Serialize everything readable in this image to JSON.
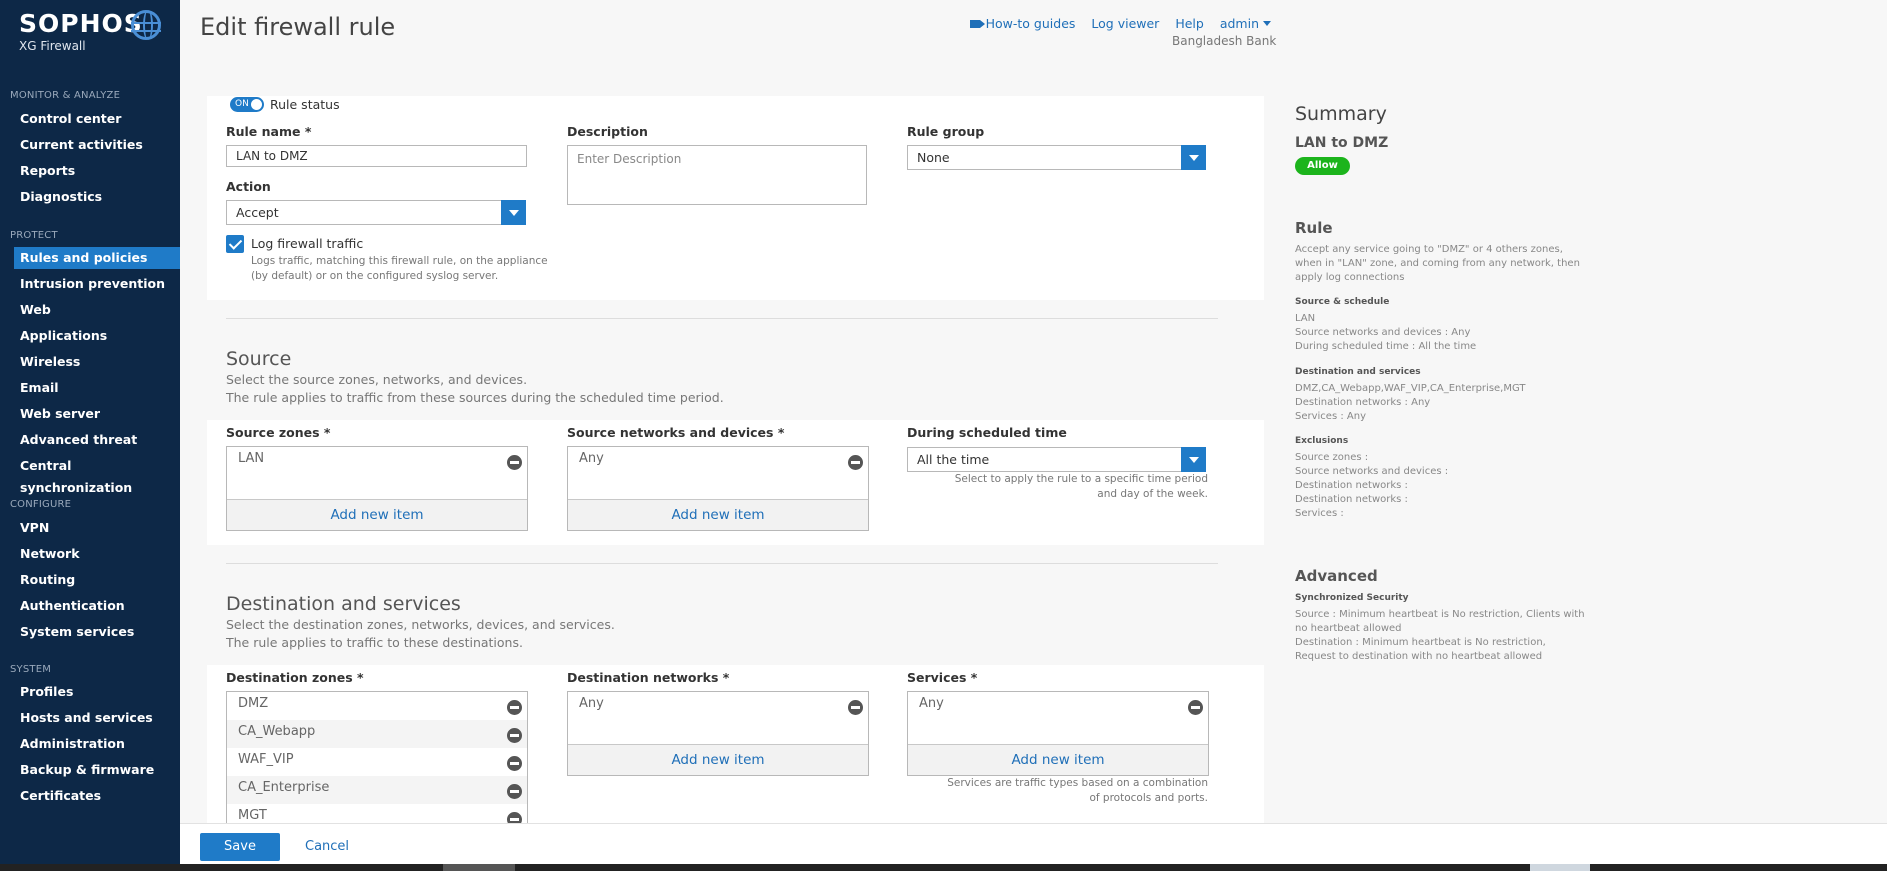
{
  "brand": {
    "name": "SOPHOS",
    "product": "XG Firewall"
  },
  "sidebar": {
    "sections": [
      {
        "title": "MONITOR & ANALYZE",
        "items": [
          "Control center",
          "Current activities",
          "Reports",
          "Diagnostics"
        ]
      },
      {
        "title": "PROTECT",
        "items": [
          "Rules and policies",
          "Intrusion prevention",
          "Web",
          "Applications",
          "Wireless",
          "Email",
          "Web server",
          "Advanced threat",
          "Central synchronization"
        ]
      },
      {
        "title": "CONFIGURE",
        "items": [
          "VPN",
          "Network",
          "Routing",
          "Authentication",
          "System services"
        ]
      },
      {
        "title": "SYSTEM",
        "items": [
          "Profiles",
          "Hosts and services",
          "Administration",
          "Backup & firmware",
          "Certificates"
        ]
      }
    ],
    "active_item": "Rules and policies"
  },
  "header": {
    "title": "Edit firewall rule",
    "links": {
      "howto": "How-to guides",
      "logviewer": "Log viewer",
      "help": "Help",
      "admin": "admin"
    },
    "org": "Bangladesh Bank"
  },
  "rule": {
    "toggle_label": "ON",
    "status_label": "Rule status",
    "name_label": "Rule name *",
    "name_value": "LAN to DMZ",
    "description_label": "Description",
    "description_placeholder": "Enter Description",
    "group_label": "Rule group",
    "group_value": "None",
    "action_label": "Action",
    "action_value": "Accept",
    "log_label": "Log firewall traffic",
    "log_checked": true,
    "log_hint": "Logs traffic, matching this firewall rule, on the appliance (by default) or on the configured syslog server."
  },
  "source": {
    "title": "Source",
    "desc1": "Select the source zones, networks, and devices.",
    "desc2": "The rule applies to traffic from these sources during the scheduled time period.",
    "zones_label": "Source zones *",
    "zones": [
      "LAN"
    ],
    "networks_label": "Source networks and devices *",
    "networks": [
      "Any"
    ],
    "schedule_label": "During scheduled time",
    "schedule_value": "All the time",
    "schedule_hint": "Select to apply the rule to a specific time period and day of the week.",
    "add_label": "Add new item"
  },
  "destination": {
    "title": "Destination and services",
    "desc1": "Select the destination zones, networks, devices, and services.",
    "desc2": "The rule applies to traffic to these destinations.",
    "zones_label": "Destination zones *",
    "zones": [
      "DMZ",
      "CA_Webapp",
      "WAF_VIP",
      "CA_Enterprise",
      "MGT"
    ],
    "networks_label": "Destination networks *",
    "networks": [
      "Any"
    ],
    "services_label": "Services *",
    "services": [
      "Any"
    ],
    "services_hint": "Services are traffic types based on a combination of protocols and ports.",
    "add_label": "Add new item"
  },
  "summary": {
    "title": "Summary",
    "rule_name": "LAN to DMZ",
    "badge": "Allow",
    "rule_heading": "Rule",
    "rule_text": "Accept any service going to \"DMZ\" or 4 others zones, when in \"LAN\" zone, and coming from any network, then apply log connections",
    "src_heading": "Source & schedule",
    "src_lines": [
      "LAN",
      "Source networks and devices : Any",
      "During scheduled time : All the time"
    ],
    "dst_heading": "Destination and services",
    "dst_lines": [
      "DMZ,CA_Webapp,WAF_VIP,CA_Enterprise,MGT",
      "Destination networks : Any",
      "Services : Any"
    ],
    "exc_heading": "Exclusions",
    "exc_lines": [
      "Source zones :",
      "Source networks and devices :",
      "Destination networks :",
      "Destination networks :",
      "Services :"
    ],
    "adv_heading": "Advanced",
    "sync_heading": "Synchronized Security",
    "sync_lines": [
      "Source : Minimum heartbeat is No restriction, Clients with no heartbeat allowed",
      "Destination : Minimum heartbeat is No restriction, Request to destination with no heartbeat allowed"
    ]
  },
  "footer": {
    "save": "Save",
    "cancel": "Cancel"
  },
  "colors": {
    "sidebar": "#0d2847",
    "accent": "#1f7bc8",
    "allow": "#1cb41c"
  }
}
